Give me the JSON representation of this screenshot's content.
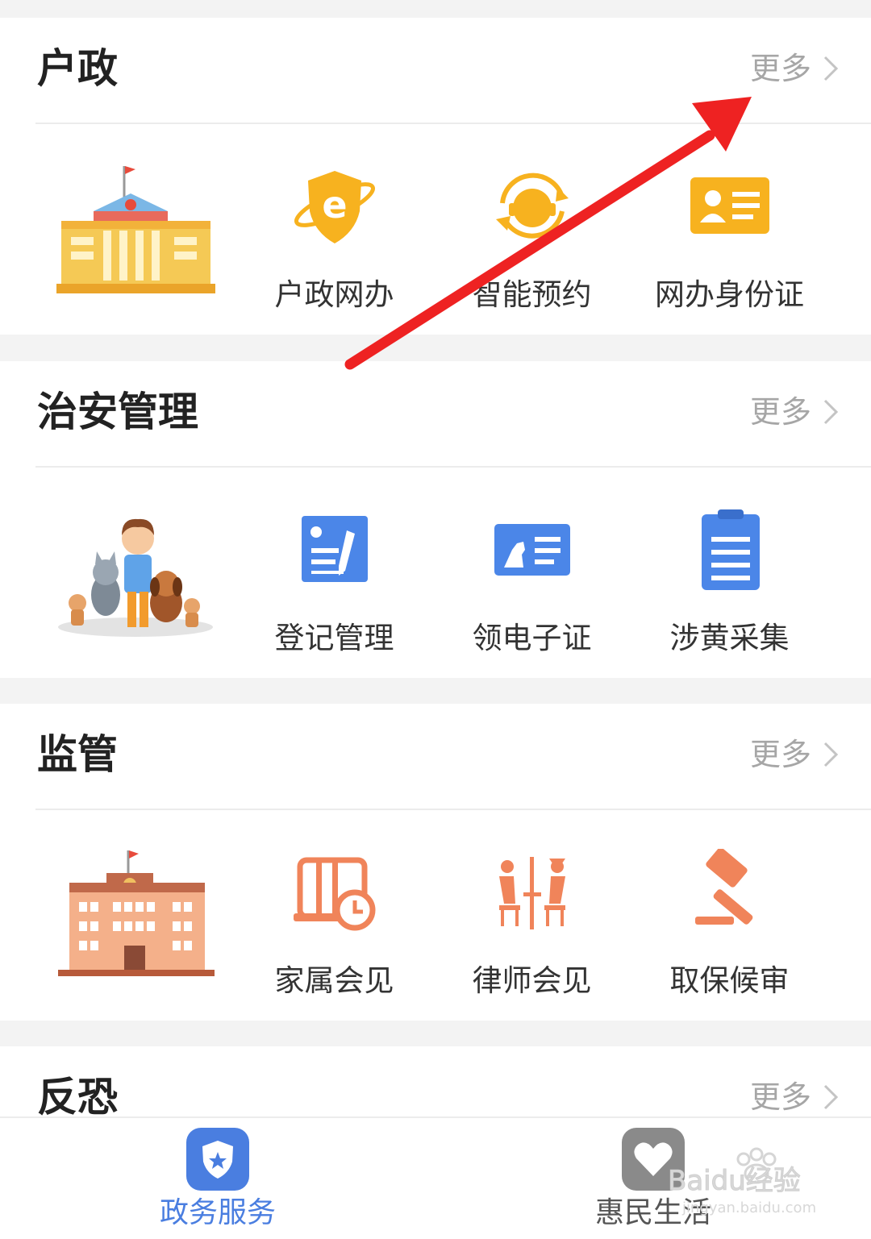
{
  "sections": [
    {
      "title": "户政",
      "more": "更多",
      "items": [
        "户政网办",
        "智能预约",
        "网办身份证"
      ]
    },
    {
      "title": "治安管理",
      "more": "更多",
      "items": [
        "登记管理",
        "领电子证",
        "涉黄采集"
      ]
    },
    {
      "title": "监管",
      "more": "更多",
      "items": [
        "家属会见",
        "律师会见",
        "取保候审"
      ]
    },
    {
      "title": "反恐",
      "more": "更多"
    }
  ],
  "tabbar": {
    "tabs": [
      {
        "label": "政务服务",
        "active": true,
        "color": "#4a7ee0"
      },
      {
        "label": "惠民生活",
        "active": false,
        "color": "#555555"
      }
    ]
  },
  "watermark": {
    "brand": "Baidu经验",
    "url": "jingyan.baidu.com"
  },
  "colors": {
    "orange": "#f7b21f",
    "blue": "#4b86e8",
    "salmon": "#f0845a",
    "arrow": "#ee2222"
  }
}
